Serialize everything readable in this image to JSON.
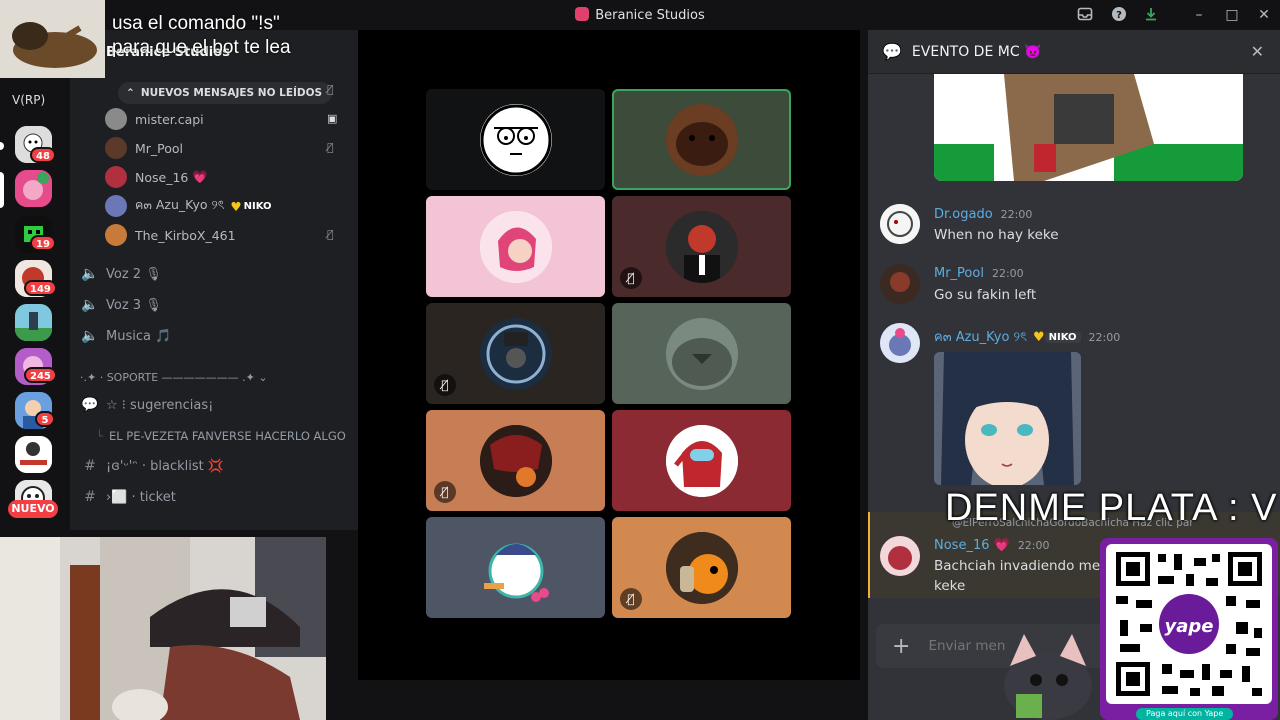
{
  "window": {
    "title": "Beranice Studios"
  },
  "overlay": {
    "caption_line1": "usa el comando \"!s\"",
    "caption_line2": "para que el bot te lea",
    "big_banner": "DENME PLATA : V",
    "qr_footer": "Paga aquí con Yape",
    "qr_brand": "yape"
  },
  "server_rail": {
    "label": "V(RP)",
    "badges": [
      "48",
      "19",
      "149",
      "245",
      "5"
    ],
    "new_pill": "NUEVO"
  },
  "channel_list": {
    "server_name": "Beranice Studios",
    "unread_banner": "NUEVOS MENSAJES NO LEÍDOS",
    "voice_users": [
      {
        "name": "mister.capi"
      },
      {
        "name": "Mr_Pool"
      },
      {
        "name": "Nose_16",
        "suffix": "💗"
      },
      {
        "name": "ค๓ Azu_Kyo ୨ৎ",
        "tag": "NIKO"
      },
      {
        "name": "The_KirboX_461"
      }
    ],
    "channels": [
      {
        "name": "Voz 2 🎙"
      },
      {
        "name": "Voz 3 🎙"
      },
      {
        "name": "Musica 🎵"
      },
      {
        "name": "·.✦ · SOPORTE ——————— .✦ ⌄"
      },
      {
        "name": "☆ ⁝ sugerencias¡"
      },
      {
        "name": "EL PE-VEZETA FANVERSE HACERLO ALGO"
      },
      {
        "name": "¡ɞ'ᵕ'ᵔ · blacklist 💢"
      },
      {
        "name": "›⬜ · ticket"
      }
    ]
  },
  "chat": {
    "title": "EVENTO DE MC 👿",
    "messages": [
      {
        "author": "Dr.ogado",
        "time": "22:00",
        "text": "When no hay keke",
        "color": "#5dade2"
      },
      {
        "author": "Mr_Pool",
        "time": "22:00",
        "text": "Go su fakin left",
        "color": "#5dade2"
      },
      {
        "author": "ค๓ Azu_Kyo ୨ৎ",
        "time": "22:00",
        "tag": "NIKO",
        "color": "#5dade2"
      },
      {
        "author": "Nose_16 💗",
        "time": "22:00",
        "text": "Bachciah invadiendo medi",
        "text2": "keke",
        "color": "#5dade2"
      }
    ],
    "reply_preview": "@ElPerroSalchichaGordoBachicha Haz clic para",
    "composer_placeholder": "Enviar men"
  },
  "colors": {
    "accent_red": "#f23f43",
    "speaking_green": "#3ba55c",
    "purple_qr": "#7b1fa2"
  }
}
